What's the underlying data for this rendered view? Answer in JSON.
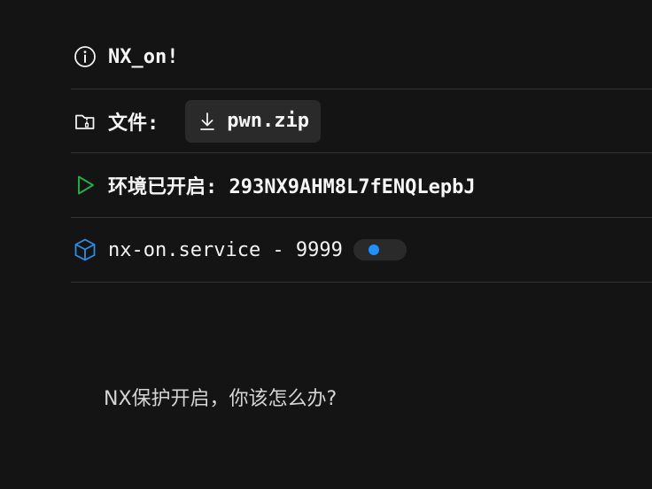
{
  "challenge": {
    "title": "NX_on!",
    "file_label": "文件:",
    "file_name": "pwn.zip",
    "env_label": "环境已开启:",
    "env_token": "293NX9AHM8L7fENQLepbJ",
    "service": "nx-on.service - 9999",
    "description": "NX保护开启，你该怎么办?"
  },
  "icons": {
    "title": "info-icon",
    "file": "folder-zip-icon",
    "download": "download-icon",
    "env": "play-icon",
    "service": "cube-icon"
  },
  "colors": {
    "play_icon": "#22b04a",
    "cube_icon": "#2a8ee6",
    "status_dot": "#1e90ff"
  }
}
